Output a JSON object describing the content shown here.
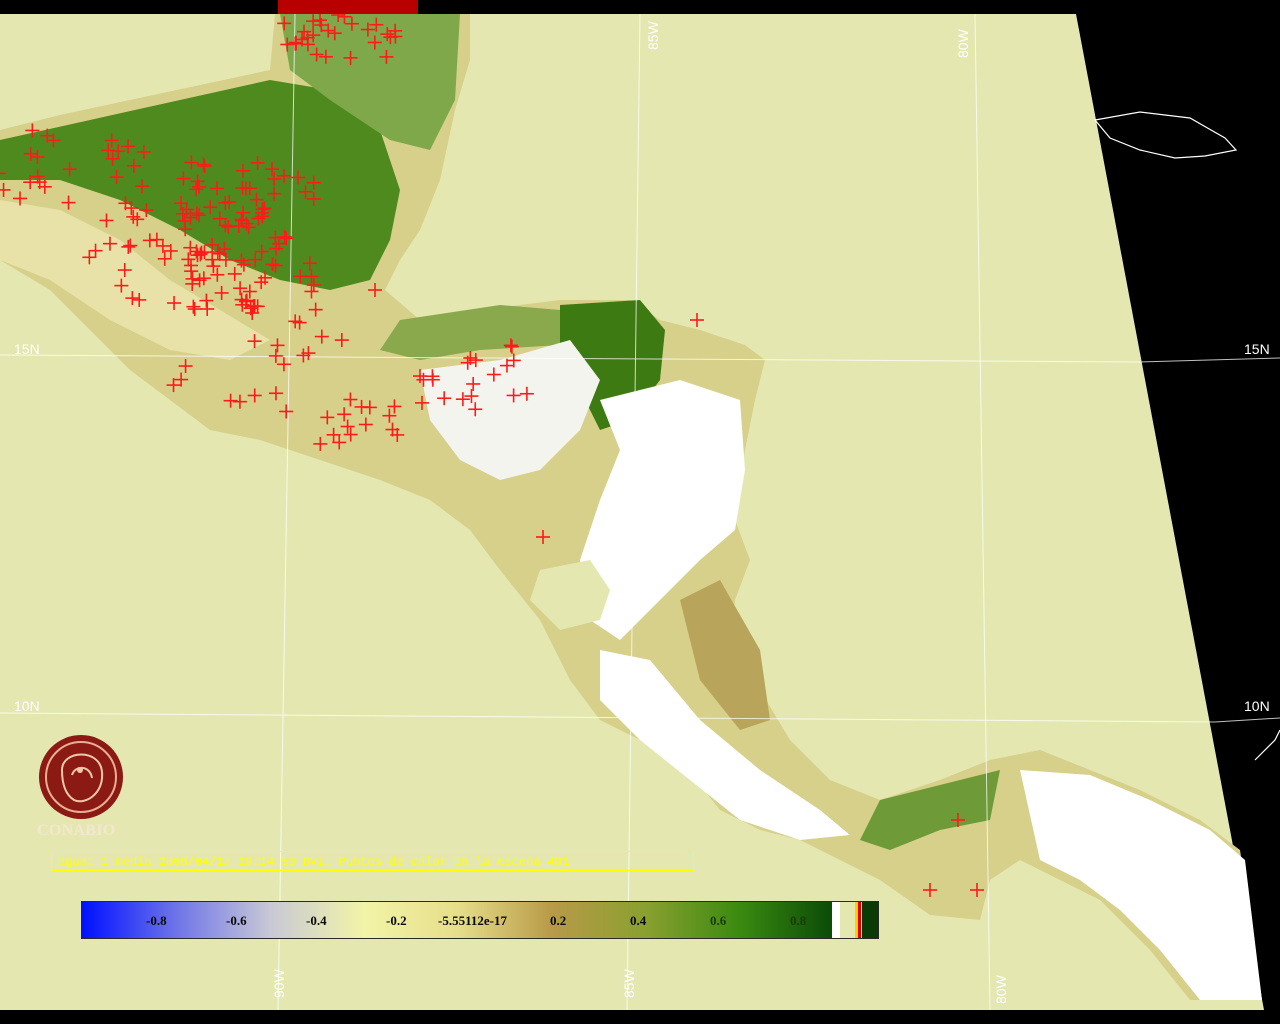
{
  "map": {
    "graticule": {
      "lon_top": [
        "85W",
        "80W"
      ],
      "lon_bottom": [
        "90W",
        "85W",
        "80W"
      ],
      "lat_left": [
        "15N",
        "10N"
      ],
      "lat_right": [
        "15N",
        "10N"
      ]
    },
    "colors": {
      "background": "#000000",
      "ocean": "#e4e8b0",
      "fire_marker": "#ff1a1a",
      "caption": "#ffff00",
      "logo": "#8b1a14"
    }
  },
  "caption": "agua: 1 media 2006/04/17 19:14:59 DVI. Puntos de calor en la escena 491",
  "logo": {
    "name": "CONABIO",
    "icon": "conabio-logo"
  },
  "colorbar": {
    "ticks": [
      "-0.8",
      "-0.6",
      "-0.4",
      "-0.2",
      "-5.55112e-17",
      "0.2",
      "0.4",
      "0.6",
      "0.8"
    ],
    "gradient": [
      "#0010ff",
      "#6e74e8",
      "#c8c8d6",
      "#f2f4a8",
      "#e6de8a",
      "#b89a48",
      "#8aa030",
      "#3a8a10",
      "#0a4a08"
    ]
  }
}
